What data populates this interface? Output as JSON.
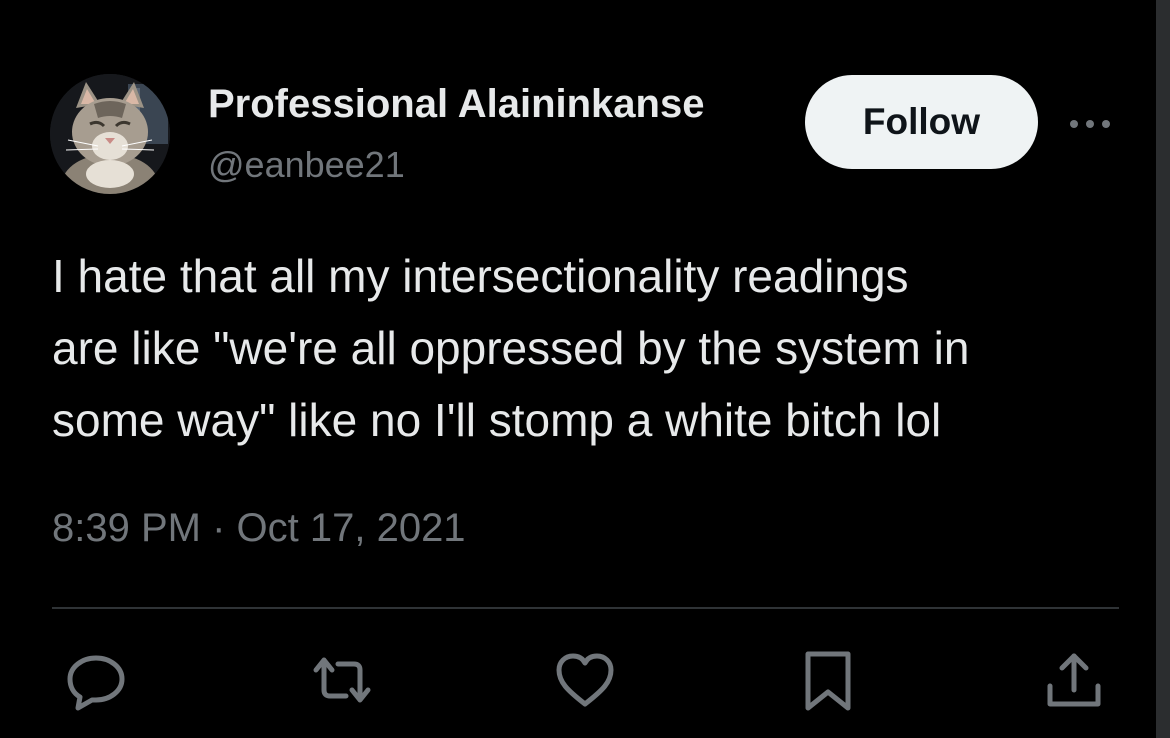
{
  "tweet": {
    "author": {
      "display_name": "Professional Alaininkanse",
      "handle": "@eanbee21",
      "avatar_icon": "cat-avatar"
    },
    "follow_label": "Follow",
    "more_icon": "more-icon",
    "text_lines": [
      "I hate that all my intersectionality readings",
      "are like \"we're all oppressed by the system in",
      "some way\" like no I'll stomp a white bitch lol"
    ],
    "timestamp": "8:39 PM · Oct 17, 2021"
  },
  "actions": [
    {
      "icon": "reply-icon"
    },
    {
      "icon": "retweet-icon"
    },
    {
      "icon": "like-icon"
    },
    {
      "icon": "bookmark-icon"
    },
    {
      "icon": "share-icon"
    }
  ],
  "colors": {
    "background": "#000000",
    "primary_text": "#e7e9ea",
    "secondary_text": "#71767b",
    "follow_bg": "#eff3f4",
    "divider": "#2f3336"
  }
}
